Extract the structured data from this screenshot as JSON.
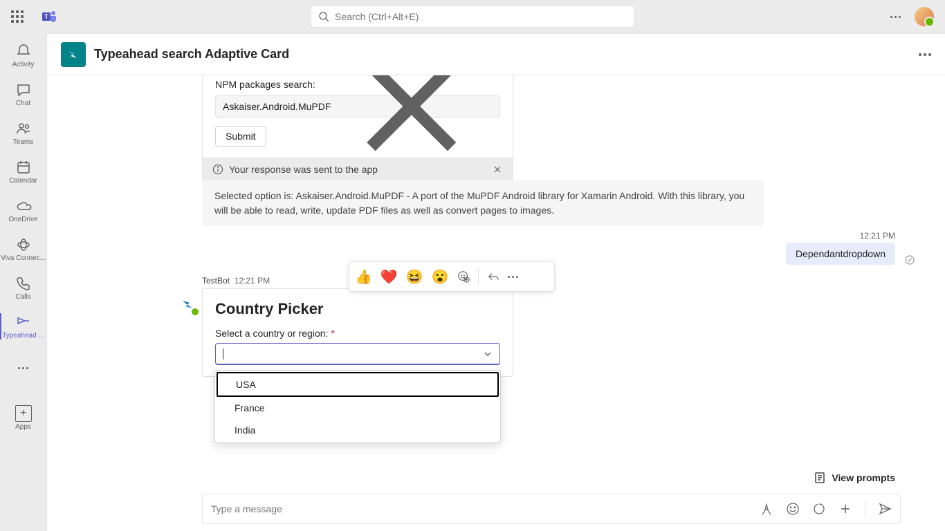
{
  "topbar": {
    "search_placeholder": "Search (Ctrl+Alt+E)"
  },
  "rail": {
    "activity": "Activity",
    "chat": "Chat",
    "teams": "Teams",
    "calendar": "Calendar",
    "onedrive": "OneDrive",
    "viva": "Viva Connec...",
    "calls": "Calls",
    "typeahead": "Typeahead ...",
    "apps": "Apps"
  },
  "header": {
    "title": "Typeahead search Adaptive Card"
  },
  "card1": {
    "label": "NPM packages search:",
    "value": "Askaiser.Android.MuPDF",
    "submit": "Submit",
    "banner": "Your response was sent to the app"
  },
  "result_text": "Selected option is: Askaiser.Android.MuPDF - A port of the MuPDF Android library for Xamarin Android. With this library, you will be able to read, write, update PDF files as well as convert pages to images.",
  "sent": {
    "time": "12:21 PM",
    "text": "Dependantdropdown"
  },
  "msg_meta": {
    "sender": "TestBot",
    "time": "12:21 PM"
  },
  "card2": {
    "title": "Country Picker",
    "label": "Select a country or region:",
    "options": [
      "USA",
      "France",
      "India"
    ]
  },
  "reactions": {
    "thumbs": "👍",
    "heart": "❤️",
    "laugh": "😆",
    "surprise": "😮"
  },
  "view_prompts": "View prompts",
  "composer_placeholder": "Type a message"
}
